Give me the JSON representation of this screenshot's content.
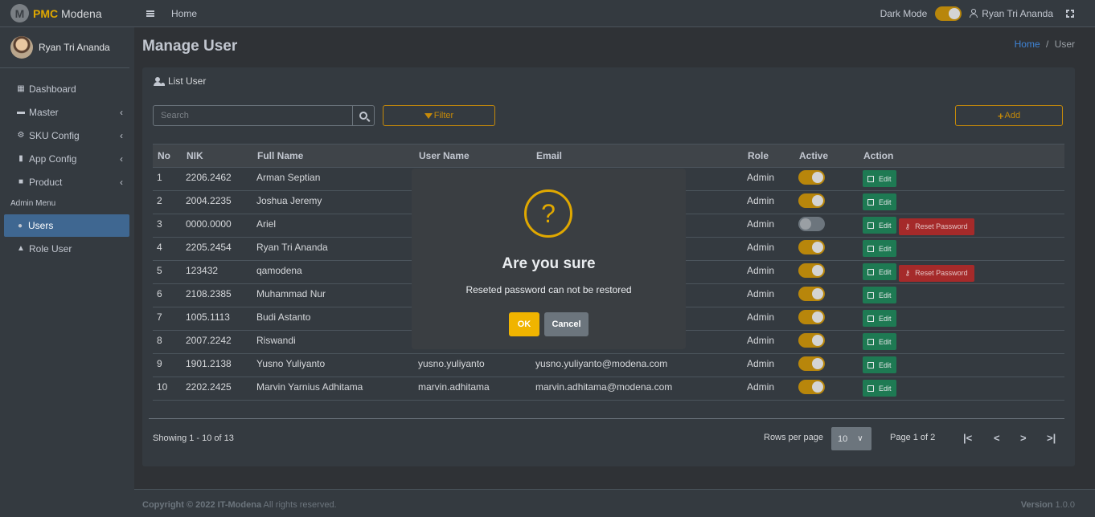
{
  "brand": {
    "bold": "PMC",
    "rest": " Modena",
    "logo_letter": "M"
  },
  "sidebar": {
    "user_name": "Ryan Tri Ananda",
    "items": [
      {
        "label": "Dashboard",
        "icon": "grid-icon"
      },
      {
        "label": "Master",
        "icon": "car-icon",
        "chevron": "‹"
      },
      {
        "label": "SKU Config",
        "icon": "gear-icon",
        "chevron": "‹"
      },
      {
        "label": "App Config",
        "icon": "mobile-icon",
        "chevron": "‹"
      },
      {
        "label": "Product",
        "icon": "briefcase-icon",
        "chevron": "‹"
      }
    ],
    "section_header": "Admin Menu",
    "admin_items": [
      {
        "label": "Users",
        "icon": "users-icon",
        "active": true
      },
      {
        "label": "Role User",
        "icon": "lock-icon"
      }
    ]
  },
  "topbar": {
    "home": "Home",
    "dark_mode_label": "Dark Mode",
    "user": "Ryan Tri Ananda"
  },
  "page": {
    "title": "Manage User",
    "breadcrumb_home": "Home",
    "breadcrumb_sep": "/",
    "breadcrumb_current": "User"
  },
  "card": {
    "title": "List User",
    "search_placeholder": "Search",
    "filter_label": "Filter",
    "add_label": "Add"
  },
  "table": {
    "headers": [
      "No",
      "NIK",
      "Full Name",
      "User Name",
      "Email",
      "Role",
      "Active",
      "Action"
    ],
    "edit_label": "Edit",
    "reset_label": "Reset Password",
    "rows": [
      {
        "no": "1",
        "nik": "2206.2462",
        "name": "Arman Septian",
        "username": "",
        "email": "",
        "role": "Admin",
        "active": true,
        "reset": false
      },
      {
        "no": "2",
        "nik": "2004.2235",
        "name": "Joshua Jeremy",
        "username": "",
        "email": "",
        "role": "Admin",
        "active": true,
        "reset": false
      },
      {
        "no": "3",
        "nik": "0000.0000",
        "name": "Ariel",
        "username": "",
        "email": "",
        "role": "Admin",
        "active": false,
        "reset": true
      },
      {
        "no": "4",
        "nik": "2205.2454",
        "name": "Ryan Tri Ananda",
        "username": "",
        "email": "",
        "role": "Admin",
        "active": true,
        "reset": false
      },
      {
        "no": "5",
        "nik": "123432",
        "name": "qamodena",
        "username": "",
        "email": "",
        "role": "Admin",
        "active": true,
        "reset": true
      },
      {
        "no": "6",
        "nik": "2108.2385",
        "name": "Muhammad Nur",
        "username": "",
        "email": "",
        "role": "Admin",
        "active": true,
        "reset": false
      },
      {
        "no": "7",
        "nik": "1005.1113",
        "name": "Budi Astanto",
        "username": "",
        "email": "",
        "role": "Admin",
        "active": true,
        "reset": false
      },
      {
        "no": "8",
        "nik": "2007.2242",
        "name": "Riswandi",
        "username": "",
        "email": "",
        "role": "Admin",
        "active": true,
        "reset": false
      },
      {
        "no": "9",
        "nik": "1901.2138",
        "name": "Yusno Yuliyanto",
        "username": "yusno.yuliyanto",
        "email": "yusno.yuliyanto@modena.com",
        "role": "Admin",
        "active": true,
        "reset": false
      },
      {
        "no": "10",
        "nik": "2202.2425",
        "name": "Marvin Yarnius Adhitama",
        "username": "marvin.adhitama",
        "email": "marvin.adhitama@modena.com",
        "role": "Admin",
        "active": true,
        "reset": false
      }
    ]
  },
  "pagination": {
    "showing": "Showing 1 - 10 of 13",
    "rows_per_page_label": "Rows per page",
    "rows_per_page_value": "10",
    "page_info": "Page 1 of 2",
    "first": "|<",
    "prev": "<",
    "next": ">",
    "last": ">|"
  },
  "modal": {
    "icon": "?",
    "title": "Are you sure",
    "text": "Reseted password can not be restored",
    "ok": "OK",
    "cancel": "Cancel"
  },
  "footer": {
    "copyright_bold": "Copyright © 2022 IT-Modena",
    "copyright_rest": " All rights reserved.",
    "version_bold": "Version",
    "version_value": " 1.0.0"
  },
  "colors": {
    "accent": "#c68a09",
    "active_nav": "#3f6791",
    "edit": "#1e7a53",
    "reset": "#a52a2a"
  }
}
